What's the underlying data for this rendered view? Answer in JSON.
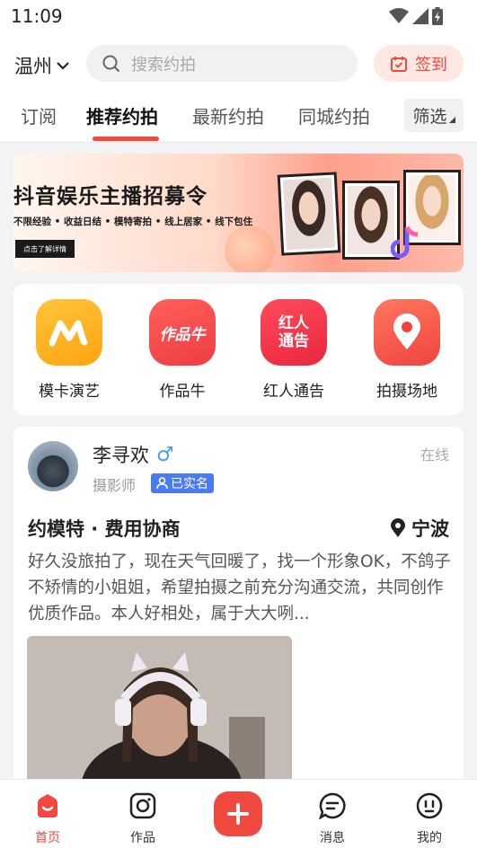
{
  "status_bar": {
    "time": "11:09"
  },
  "header": {
    "city": "温州",
    "search_placeholder": "搜索约拍",
    "signin_label": "签到"
  },
  "tabs": [
    {
      "label": "订阅",
      "active": false
    },
    {
      "label": "推荐约拍",
      "active": true
    },
    {
      "label": "最新约拍",
      "active": false
    },
    {
      "label": "同城约拍",
      "active": false
    }
  ],
  "filter_label": "筛选",
  "banner": {
    "title": "抖音娱乐主播招募令",
    "subtitle": "不限经验 • 收益日结 • 模特寄拍 • 线上居家 • 线下包住",
    "button_label": "点击了解详情"
  },
  "quick_actions": [
    {
      "label": "模卡演艺",
      "icon": "m-logo-icon",
      "color": "#ffb11f"
    },
    {
      "label": "作品牛",
      "icon": "zuopinniu-logo-icon",
      "icon_text": "作品牛",
      "color": "#f24b4b"
    },
    {
      "label": "红人通告",
      "icon": "hongren-tonggao-icon",
      "icon_text": "红人\n通告",
      "color": "#f0374a"
    },
    {
      "label": "拍摄场地",
      "icon": "location-pin-icon",
      "color": "#f35a4a"
    }
  ],
  "post": {
    "username": "李寻欢",
    "gender_symbol": "♂",
    "role": "摄影师",
    "verified_label": "已实名",
    "online_status": "在线",
    "title": "约模特 · 费用协商",
    "location": "宁波",
    "body": "好久没旅拍了，现在天气回暖了，找一个形象OK，不鸽子不矫情的小姐姐，希望拍摄之前充分沟通交流，共同创作优质作品。本人好相处，属于大大咧..."
  },
  "bottom_nav": [
    {
      "label": "首页",
      "icon": "home-icon",
      "active": true
    },
    {
      "label": "作品",
      "icon": "camera-icon",
      "active": false
    },
    {
      "label": "",
      "icon": "plus-icon",
      "active": false
    },
    {
      "label": "消息",
      "icon": "message-icon",
      "active": false
    },
    {
      "label": "我的",
      "icon": "profile-icon",
      "active": false
    }
  ],
  "colors": {
    "accent": "#f0493f",
    "verified_blue": "#4b7bf0",
    "background": "#f3f3f5"
  }
}
